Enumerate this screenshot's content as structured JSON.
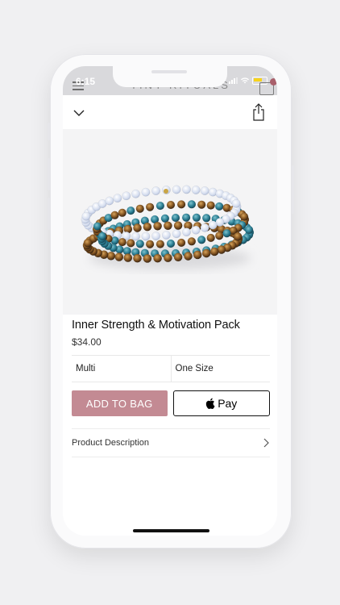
{
  "status_bar": {
    "time": "6:15",
    "background_logo": "TINY RITUALS"
  },
  "icons": {
    "collapse": "chevron-down-icon",
    "share": "share-icon",
    "apple": "apple-logo-icon",
    "disclosure": "chevron-right-icon",
    "menu": "hamburger-menu-icon",
    "bag": "shopping-bag-icon"
  },
  "product": {
    "title": "Inner Strength & Motivation Pack",
    "price": "$34.00",
    "options": {
      "color": "Multi",
      "size": "One Size"
    }
  },
  "actions": {
    "add_to_bag": "ADD TO BAG",
    "apple_pay": "Pay"
  },
  "description": {
    "label": "Product Description"
  },
  "colors": {
    "accent": "#c38a93",
    "text": "#111111",
    "divider": "#e8e8e8"
  }
}
